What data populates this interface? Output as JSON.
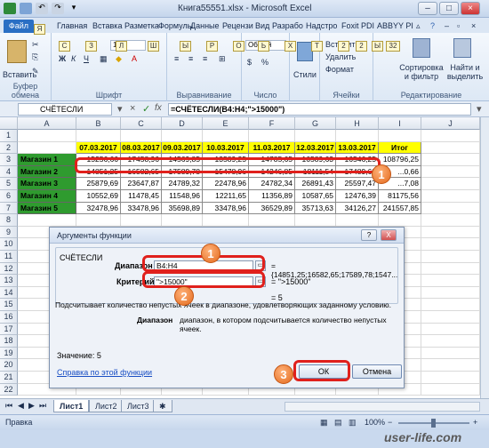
{
  "window": {
    "title": "Книга55551.xlsx - Microsoft Excel",
    "file_tab": "Файл"
  },
  "ribbon_tabs": [
    "Главная",
    "Вставка",
    "Разметка",
    "Формулы",
    "Данные",
    "Рецензи",
    "Вид",
    "Разрабо",
    "Надстро",
    "Foxit PDI",
    "ABBYY PI"
  ],
  "key_tips": [
    "Я",
    "С",
    "З",
    "Л",
    "Ш",
    "Ы",
    "Р",
    "О",
    "Ь",
    "Х",
    "Т",
    "2",
    "2",
    "Ы",
    "32"
  ],
  "ribbon": {
    "paste": "Вставить",
    "clipboard": "Буфер обмена",
    "font_group": "Шрифт",
    "font_size": "11",
    "bold": "Ж",
    "italic": "К",
    "underline": "Ч",
    "align_group": "Выравнивание",
    "number_group": "Число",
    "number_format": "Общий",
    "styles": "Стили",
    "insert": "Вставить",
    "delete": "Удалить",
    "format": "Формат",
    "cells_group": "Ячейки",
    "sort": "Сортировка\nи фильтр",
    "find": "Найти и\nвыделить",
    "edit_group": "Редактирование"
  },
  "formula_bar": {
    "name_box": "СЧЁТЕСЛИ",
    "fx": "fx",
    "formula": "=СЧЁТЕСЛИ(B4:H4;\">15000\")"
  },
  "columns": [
    "A",
    "B",
    "C",
    "D",
    "E",
    "F",
    "G",
    "H",
    "I",
    "J"
  ],
  "rows": [
    "1",
    "2",
    "3",
    "4",
    "5",
    "6",
    "7",
    "8",
    "9",
    "10",
    "11",
    "12",
    "13",
    "14",
    "15",
    "16",
    "17",
    "18",
    "19",
    "20",
    "21",
    "22"
  ],
  "sheet": {
    "headers": [
      "07.03.2017",
      "08.03.2017",
      "09.03.2017",
      "10.03.2017",
      "11.03.2017",
      "12.03.2017",
      "13.03.2017",
      "Итог"
    ],
    "data": [
      {
        "label": "Магазин 1",
        "values": [
          "15256,66",
          "17458,96",
          "14569,85",
          "13589,25",
          "14785,65",
          "16589,63",
          "16546,25",
          "108796,25"
        ]
      },
      {
        "label": "Магазин 2",
        "values": [
          "14851,25",
          "16582,65",
          "17589,78",
          "15478,96",
          "14246,85",
          "18111,54",
          "17489,63",
          "...0,66"
        ]
      },
      {
        "label": "Магазин 3",
        "values": [
          "25879,69",
          "23647,87",
          "24789,32",
          "22478,96",
          "24782,34",
          "26891,43",
          "25597,47",
          "...7,08"
        ]
      },
      {
        "label": "Магазин 4",
        "values": [
          "10552,69",
          "11478,45",
          "11548,96",
          "12211,65",
          "11356,89",
          "10587,65",
          "12476,39",
          "81175,56"
        ]
      },
      {
        "label": "Магазин 5",
        "values": [
          "32478,96",
          "33478,96",
          "35698,89",
          "33478,96",
          "36529,89",
          "35713,63",
          "34126,27",
          "241557,85"
        ]
      }
    ]
  },
  "dialog": {
    "title": "Аргументы функции",
    "help_btn": "?",
    "close_btn": "X",
    "function_name": "СЧЁТЕСЛИ",
    "range_label": "Диапазон",
    "range_value": "B4:H4",
    "range_result": "= {14851,25;16582,65;17589,78;1547...",
    "criteria_label": "Критерий",
    "criteria_value": "\">15000\"",
    "criteria_result": "= \">15000\"",
    "result_eq": "= 5",
    "description": "Подсчитывает количество непустых ячеек в диапазоне, удовлетворяющих заданному условию.",
    "arg_name": "Диапазон",
    "arg_desc": "диапазон, в котором подсчитывается количество непустых ячеек.",
    "value_line": "Значение:  5",
    "help_link": "Справка по этой функции",
    "ok": "ОК",
    "cancel": "Отмена"
  },
  "badges": [
    "1",
    "1",
    "2",
    "3"
  ],
  "sheet_tabs": [
    "Лист1",
    "Лист2",
    "Лист3"
  ],
  "status": {
    "mode": "Правка",
    "zoom": "100%"
  },
  "watermark": "user-life.com",
  "colors": {
    "header_yellow": "#ffff00",
    "label_green": "#2f9b2f",
    "annotation_red": "#e0201c",
    "badge_orange": "#e36a1d"
  }
}
